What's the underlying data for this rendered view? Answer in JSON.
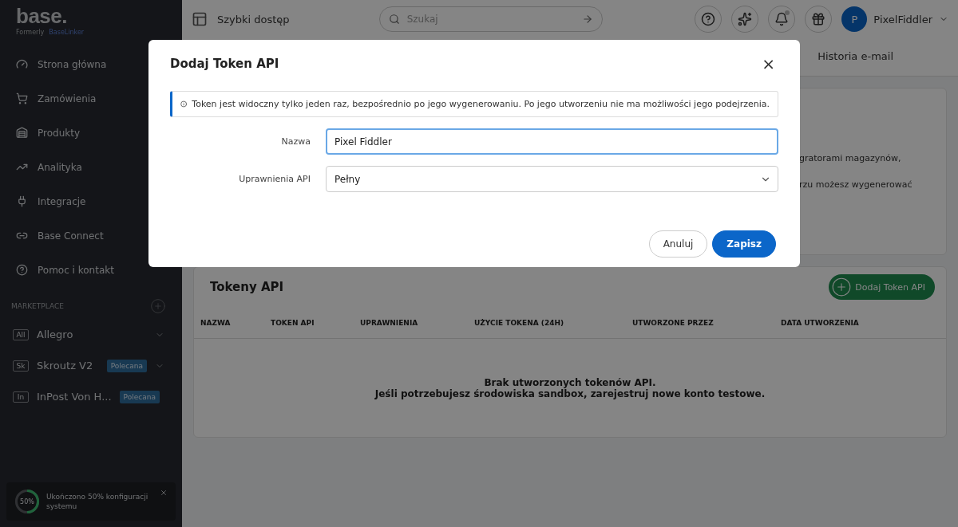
{
  "sidebar": {
    "logo": "base.",
    "formerly": "Formerly",
    "former_brand": "BaseLinker",
    "items": [
      {
        "label": "Strona główna",
        "kind": "gauge"
      },
      {
        "label": "Zamówienia",
        "kind": "cart"
      },
      {
        "label": "Produkty",
        "kind": "warehouse"
      },
      {
        "label": "Analityka",
        "kind": "chart"
      },
      {
        "label": "Integracje",
        "kind": "plug"
      },
      {
        "label": "Base Connect",
        "kind": "link"
      },
      {
        "label": "Pomoc i kontakt",
        "kind": "help"
      }
    ],
    "section_title": "MARKETPLACE",
    "marketplaces": [
      {
        "code": "All",
        "label": "Allegro"
      },
      {
        "code": "Sk",
        "label": "Skroutz V2",
        "badge": "Polecana"
      },
      {
        "code": "In",
        "label": "InPost Von H...",
        "badge": "Polecana"
      }
    ],
    "progress": {
      "level": 0.5,
      "reading": "50%",
      "text": "Ukończono 50% konfiguracji systemu"
    }
  },
  "header": {
    "quick_access": "Szybki dostęp",
    "search": {
      "placeholder": "Szukaj"
    },
    "avatar": "P",
    "user": "PixelFiddler"
  },
  "tabs": [
    {
      "label": "Historia e-mail",
      "selected": false
    }
  ],
  "info_card": {
    "lines": [
      "gratorami magazynów,",
      "rzu możesz wygenerować"
    ]
  },
  "tokens": {
    "title": "Tokeny API",
    "add_button": "Dodaj Token API",
    "columns": [
      "NAZWA",
      "TOKEN API",
      "UPRAWNIENIA",
      "UŻYCIE TOKENA (24H)",
      "UTWORZONE PRZEZ",
      "DATA UTWORZENIA"
    ],
    "empty": [
      "Brak utworzonych tokenów API.",
      "Jeśli potrzebujesz środowiska sandbox, zarejestruj nowe konto testowe."
    ]
  },
  "modal": {
    "title": "Dodaj Token API",
    "close": "×",
    "alert": "Token jest widoczny tylko jeden raz, bezpośrednio po jego wygenerowaniu. Po jego utworzeniu nie ma możliwości jego podejrzenia.",
    "fields": [
      {
        "label": "Nazwa",
        "value": "Pixel Fiddler",
        "kind": "text"
      },
      {
        "label": "Uprawnienia API",
        "value": "Pełny",
        "kind": "select"
      }
    ],
    "buttons": [
      {
        "label": "Anuluj",
        "kind": "secondary"
      },
      {
        "label": "Zapisz",
        "kind": "primary"
      }
    ]
  }
}
